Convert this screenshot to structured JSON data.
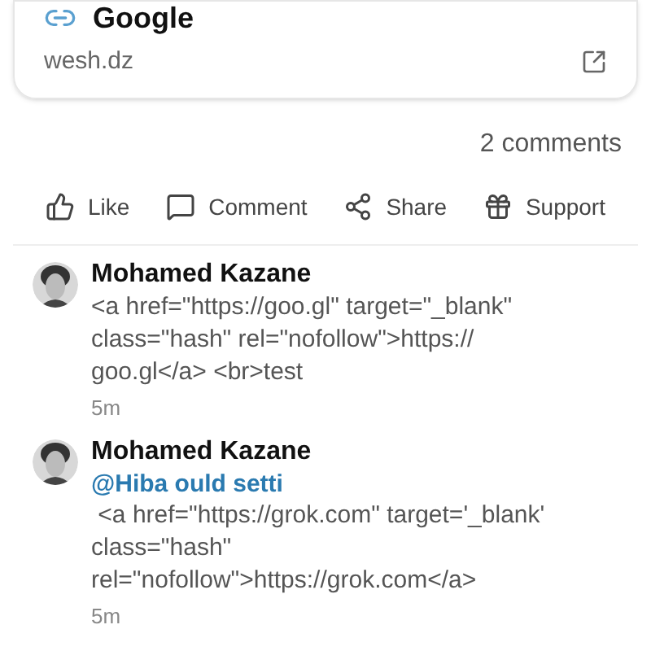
{
  "link_card": {
    "title": "Google",
    "domain": "wesh.dz"
  },
  "comment_count": "2 comments",
  "actions": [
    {
      "kind": "like",
      "label": "Like"
    },
    {
      "kind": "comment",
      "label": "Comment"
    },
    {
      "kind": "share",
      "label": "Share"
    },
    {
      "kind": "support",
      "label": "Support"
    }
  ],
  "comments": [
    {
      "author": "Mohamed Kazane",
      "text": "<a href=\"https://goo.gl\" target=\"_blank\" class=\"hash\" rel=\"nofollow\">https:// goo.gl</a> <br>test",
      "time": "5m"
    },
    {
      "author": "Mohamed Kazane",
      "mention": "@Hiba ould setti",
      "text": " <a href=\"https://grok.com\" target='_blank' class=\"hash\" rel=\"nofollow\">https://grok.com</a>",
      "time": "5m"
    }
  ]
}
